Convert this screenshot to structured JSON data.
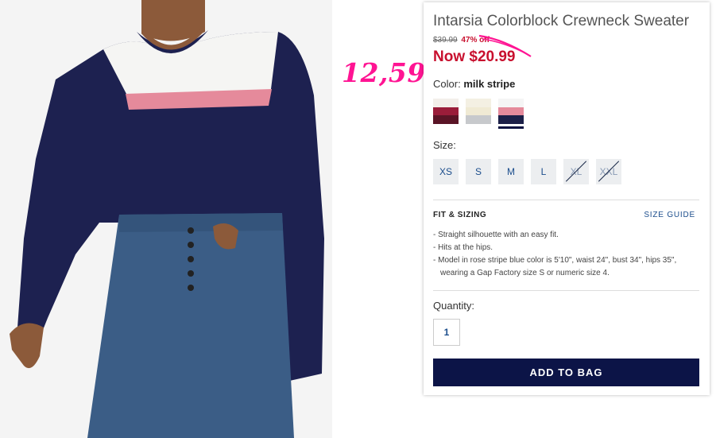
{
  "product": {
    "title": "Intarsia Colorblock Crewneck Sweater",
    "old_price": "$39.99",
    "discount": "47% off",
    "now_price": "Now $20.99"
  },
  "annotation": {
    "handwritten_price": "12,59",
    "color": "#ff1493"
  },
  "color": {
    "label": "Color:",
    "selected": "milk stripe",
    "swatches": [
      {
        "name": "burgundy stripe",
        "top": "#f3efea",
        "mid": "#9a1d3a",
        "bottom": "#5a1426"
      },
      {
        "name": "ivory stripe",
        "top": "#f4f0e3",
        "mid": "#f0ead4",
        "bottom": "#c7c9cc"
      },
      {
        "name": "milk stripe",
        "top": "#f5f5f5",
        "mid": "#e58a9b",
        "bottom": "#1c2048",
        "selected": true
      }
    ]
  },
  "size": {
    "label": "Size:",
    "options": [
      {
        "label": "XS",
        "available": true
      },
      {
        "label": "S",
        "available": true
      },
      {
        "label": "M",
        "available": true
      },
      {
        "label": "L",
        "available": true
      },
      {
        "label": "XL",
        "available": false
      },
      {
        "label": "XXL",
        "available": false
      }
    ]
  },
  "fit": {
    "title": "FIT & SIZING",
    "size_guide": "SIZE GUIDE",
    "bullets": [
      "- Straight silhouette with an easy fit.",
      "- Hits at the hips.",
      "- Model in rose stripe blue color is 5'10\", waist 24\", bust 34\", hips 35\", wearing a Gap Factory size S or numeric size 4."
    ]
  },
  "quantity": {
    "label": "Quantity:",
    "value": "1"
  },
  "cta": {
    "add_to_bag": "ADD TO BAG",
    "color": "#0c1447"
  }
}
